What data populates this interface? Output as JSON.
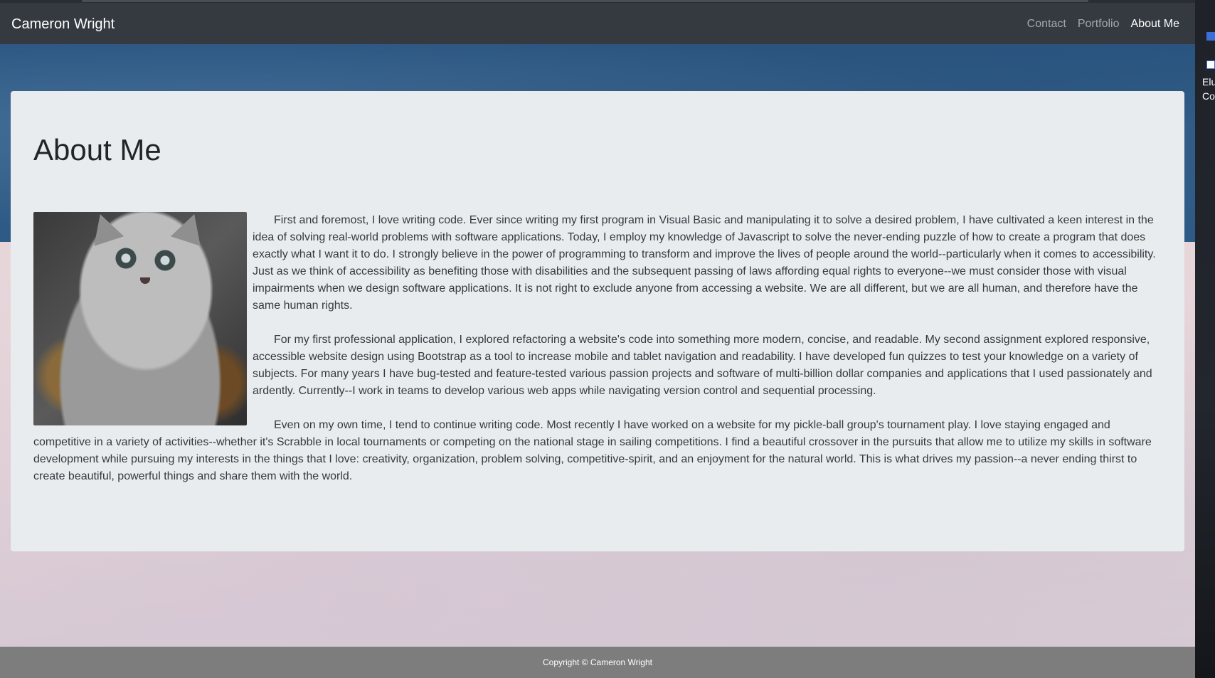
{
  "navbar": {
    "brand": "Cameron Wright",
    "links": [
      {
        "label": "Contact",
        "active": false
      },
      {
        "label": "Portfolio",
        "active": false
      },
      {
        "label": "About Me",
        "active": true
      }
    ]
  },
  "main": {
    "title": "About Me",
    "image_alt": "kitten photo",
    "paragraphs": [
      "First and foremost, I love writing code. Ever since writing my first program in Visual Basic and manipulating it to solve a desired problem, I have cultivated a keen interest in the idea of solving real-world problems with software applications. Today, I employ my knowledge of Javascript to solve the never-ending puzzle of how to create a program that does exactly what I want it to do. I strongly believe in the power of programming to transform and improve the lives of people around the world--particularly when it comes to accessibility. Just as we think of accessibility as benefiting those with disabilities and the subsequent passing of laws affording equal rights to everyone--we must consider those with visual impairments when we design software applications. It is not right to exclude anyone from accessing a website. We are all different, but we are all human, and therefore have the same human rights.",
      "For my first professional application, I explored refactoring a website's code into something more modern, concise, and readable. My second assignment explored responsive, accessible website design using Bootstrap as a tool to increase mobile and tablet navigation and readability. I have developed fun quizzes to test your knowledge on a variety of subjects. For many years I have bug-tested and feature-tested various passion projects and software of multi-billion dollar companies and applications that I used passionately and ardently. Currently--I work in teams to develop various web apps while navigating version control and sequential processing.",
      "Even on my own time, I tend to continue writing code. Most recently I have worked on a website for my pickle-ball group's tournament play. I love staying engaged and competitive in a variety of activities--whether it's Scrabble in local tournaments or competing on the national stage in sailing competitions. I find a beautiful crossover in the pursuits that allow me to utilize my skills in software development while pursuing my interests in the things that I love: creativity, organization, problem solving, competitive-spirit, and an enjoyment for the natural world. This is what drives my passion--a never ending thirst to create beautiful, powerful things and share them with the world."
    ]
  },
  "footer": {
    "copyright": "Copyright © Cameron Wright"
  },
  "desktop": {
    "label_line1": "Elu",
    "label_line2": "Co"
  },
  "colors": {
    "navbar_bg": "#343a40",
    "card_bg": "#e9ecef",
    "footer_bg": "#7d7d7d"
  }
}
